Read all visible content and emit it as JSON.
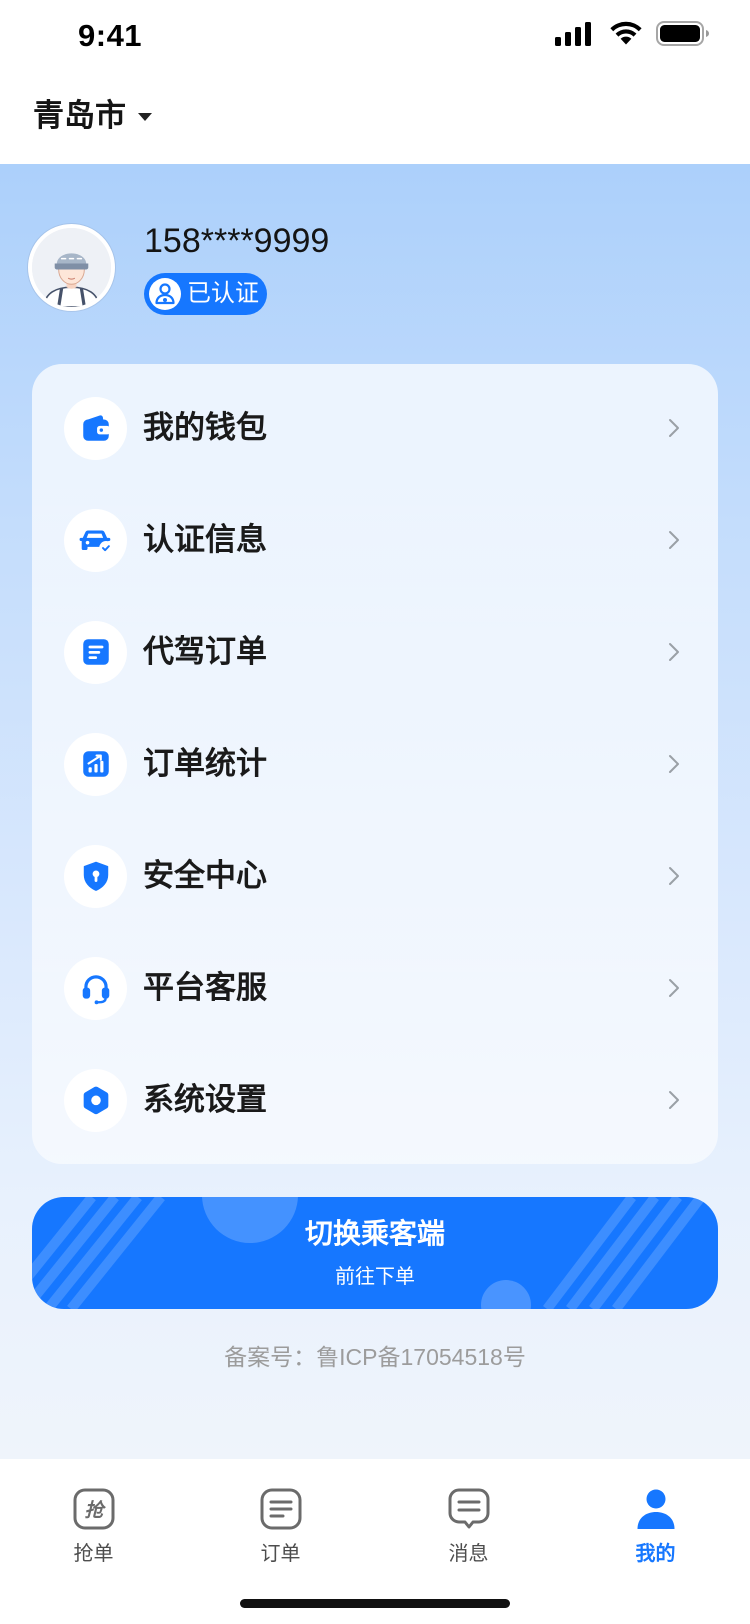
{
  "status_bar": {
    "time": "9:41",
    "icons": [
      "signal-icon",
      "wifi-icon",
      "battery-icon"
    ]
  },
  "header": {
    "city": "青岛市",
    "city_dropdown_icon": "caret-down-icon"
  },
  "profile": {
    "avatar_icon": "driver-avatar",
    "phone": "158****9999",
    "badge": "已认证",
    "badge_icon": "verified-driver-icon"
  },
  "menu": {
    "items": [
      {
        "label": "我的钱包",
        "icon": "wallet-icon"
      },
      {
        "label": "认证信息",
        "icon": "car-verified-icon"
      },
      {
        "label": "代驾订单",
        "icon": "order-list-icon"
      },
      {
        "label": "订单统计",
        "icon": "statistics-icon"
      },
      {
        "label": "安全中心",
        "icon": "shield-icon"
      },
      {
        "label": "平台客服",
        "icon": "headset-icon"
      },
      {
        "label": "系统设置",
        "icon": "settings-icon"
      }
    ]
  },
  "switch_button": {
    "title": "切换乘客端",
    "subtitle": "前往下单"
  },
  "footer": {
    "icp": "备案号：鲁ICP备17054518号"
  },
  "tab_bar": {
    "items": [
      {
        "label": "抢单",
        "icon": "grab-order-icon",
        "icon_glyph": "抢",
        "active": false
      },
      {
        "label": "订单",
        "icon": "orders-icon",
        "active": false
      },
      {
        "label": "消息",
        "icon": "message-icon",
        "active": false
      },
      {
        "label": "我的",
        "icon": "profile-icon",
        "active": true
      }
    ]
  },
  "colors": {
    "accent": "#1677ff",
    "text_primary": "#1a1a1a",
    "text_secondary": "#9c9c9c",
    "tab_inactive": "#6b6b6b",
    "background_top": "#acd0fb",
    "background_bottom": "#eff4fb"
  }
}
